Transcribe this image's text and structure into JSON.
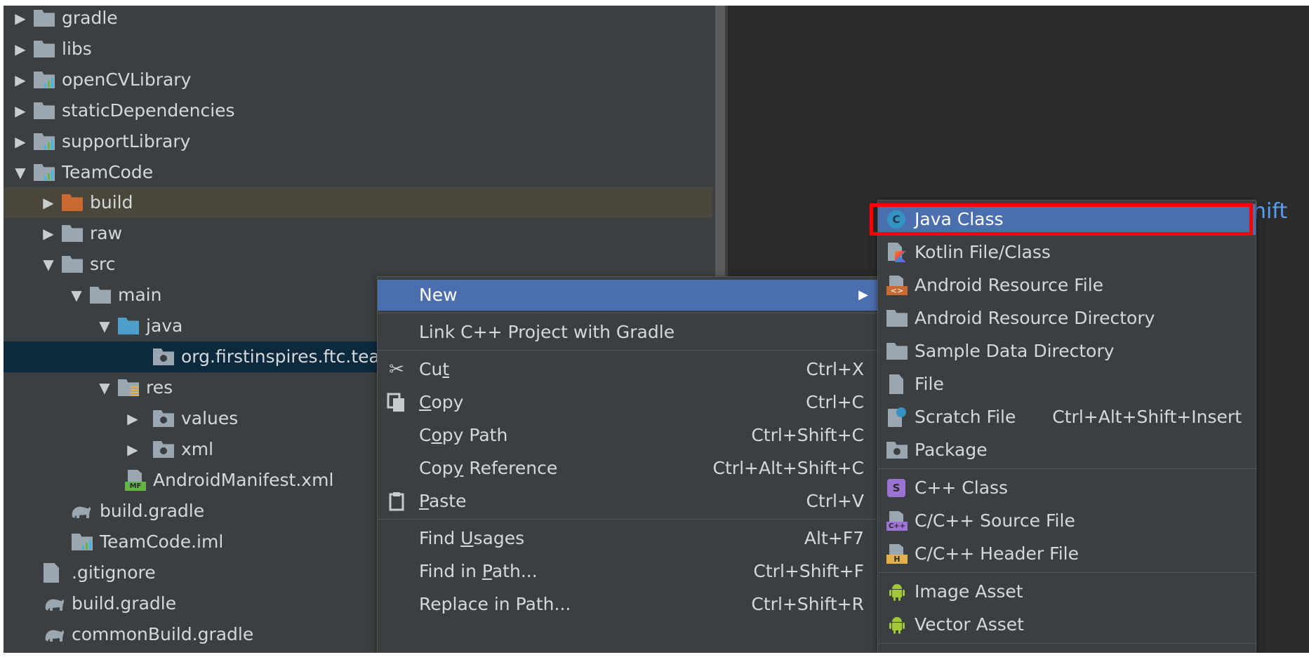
{
  "tree": {
    "items": [
      {
        "label": "gradle",
        "arrow": "▶",
        "icon": "folder-icon"
      },
      {
        "label": "libs",
        "arrow": "▶",
        "icon": "folder-icon"
      },
      {
        "label": "openCVLibrary",
        "arrow": "▶",
        "icon": "module-icon"
      },
      {
        "label": "staticDependencies",
        "arrow": "▶",
        "icon": "folder-icon"
      },
      {
        "label": "supportLibrary",
        "arrow": "▶",
        "icon": "module-icon"
      },
      {
        "label": "TeamCode",
        "arrow": "▼",
        "icon": "module-icon"
      },
      {
        "label": "build",
        "arrow": "▶",
        "icon": "excluded-folder-icon"
      },
      {
        "label": "raw",
        "arrow": "▶",
        "icon": "folder-icon"
      },
      {
        "label": "src",
        "arrow": "▼",
        "icon": "folder-icon"
      },
      {
        "label": "main",
        "arrow": "▼",
        "icon": "folder-icon"
      },
      {
        "label": "java",
        "arrow": "▼",
        "icon": "source-folder-icon"
      },
      {
        "label": "org.firstinspires.ftc.teamcode",
        "arrow": "",
        "icon": "package-icon"
      },
      {
        "label": "res",
        "arrow": "▼",
        "icon": "resource-folder-icon"
      },
      {
        "label": "values",
        "arrow": "▶",
        "icon": "package-icon"
      },
      {
        "label": "xml",
        "arrow": "▶",
        "icon": "package-icon"
      },
      {
        "label": "AndroidManifest.xml",
        "arrow": "",
        "icon": "manifest-icon"
      },
      {
        "label": "build.gradle",
        "arrow": "",
        "icon": "gradle-icon"
      },
      {
        "label": "TeamCode.iml",
        "arrow": "",
        "icon": "module-icon"
      },
      {
        "label": ".gitignore",
        "arrow": "",
        "icon": "text-file-icon"
      },
      {
        "label": "build.gradle",
        "arrow": "",
        "icon": "gradle-icon"
      },
      {
        "label": "commonBuild.gradle",
        "arrow": "",
        "icon": "gradle-icon"
      }
    ]
  },
  "editor": {
    "hint_text": "hift"
  },
  "context_menu": {
    "new": {
      "label": "New",
      "arrow": "▶"
    },
    "link_cpp": {
      "label": "Link C++ Project with Gradle"
    },
    "cut": {
      "pre": "Cu",
      "u": "t",
      "post": "",
      "shortcut": "Ctrl+X"
    },
    "copy": {
      "pre": "",
      "u": "C",
      "post": "opy",
      "shortcut": "Ctrl+C"
    },
    "copy_path": {
      "pre": "C",
      "u": "o",
      "post": "py Path",
      "shortcut": "Ctrl+Shift+C"
    },
    "copy_reference": {
      "pre": "Cop",
      "u": "y",
      "post": " Reference",
      "shortcut": "Ctrl+Alt+Shift+C"
    },
    "paste": {
      "pre": "",
      "u": "P",
      "post": "aste",
      "shortcut": "Ctrl+V"
    },
    "find_usages": {
      "pre": "Find ",
      "u": "U",
      "post": "sages",
      "shortcut": "Alt+F7"
    },
    "find_in_path": {
      "pre": "Find in ",
      "u": "P",
      "post": "ath...",
      "shortcut": "Ctrl+Shift+F"
    },
    "replace_in_path": {
      "label": "Replace in Path...",
      "shortcut": "Ctrl+Shift+R"
    }
  },
  "submenu": {
    "java_class": {
      "label": "Java Class",
      "icon_letter": "C"
    },
    "kotlin": {
      "label": "Kotlin File/Class"
    },
    "android_resource_file": {
      "label": "Android Resource File",
      "icon_text": "<>"
    },
    "android_resource_directory": {
      "label": "Android Resource Directory"
    },
    "sample_data_directory": {
      "label": "Sample Data Directory"
    },
    "file": {
      "label": "File"
    },
    "scratch_file": {
      "label": "Scratch File",
      "shortcut": "Ctrl+Alt+Shift+Insert"
    },
    "package": {
      "label": "Package"
    },
    "cpp_class": {
      "label": "C++ Class",
      "icon_letter": "S"
    },
    "cpp_source": {
      "label": "C/C++ Source File",
      "icon_text": "C++"
    },
    "cpp_header": {
      "label": "C/C++ Header File",
      "icon_text": "H"
    },
    "image_asset": {
      "label": "Image Asset"
    },
    "vector_asset": {
      "label": "Vector Asset"
    }
  },
  "colors": {
    "tree_bg": "#3c3f41",
    "selection_blue": "#4b6eaf",
    "package_selected": "#0d293e",
    "excluded_row": "#4b463c",
    "highlight_red": "#ff0000",
    "android_green": "#a4c639"
  }
}
